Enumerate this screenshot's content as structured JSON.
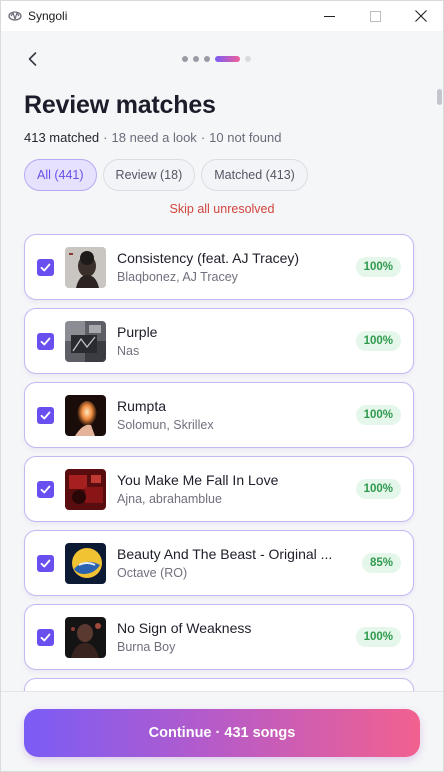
{
  "window": {
    "app_title": "Syngoli",
    "controls": {
      "minimize": "—",
      "maximize": "☐",
      "close": "✕"
    }
  },
  "header": {
    "title": "Review matches",
    "summary": {
      "matched": "413 matched",
      "need_look": "18 need a look",
      "not_found": "10 not found",
      "separator": "·"
    },
    "step": {
      "total": 5,
      "current": 4
    }
  },
  "filters": [
    {
      "label": "All (441)",
      "active": true
    },
    {
      "label": "Review (18)",
      "active": false
    },
    {
      "label": "Matched (413)",
      "active": false
    }
  ],
  "skip_link": "Skip all unresolved",
  "tracks": [
    {
      "title": "Consistency (feat. AJ Tracey)",
      "artist": "Blaqbonez, AJ Tracey",
      "match": "100%",
      "checked": true,
      "art": "art-consistency"
    },
    {
      "title": "Purple",
      "artist": "Nas",
      "match": "100%",
      "checked": true,
      "art": "art-purple"
    },
    {
      "title": "Rumpta",
      "artist": "Solomun, Skrillex",
      "match": "100%",
      "checked": true,
      "art": "art-rumpta"
    },
    {
      "title": "You Make Me Fall In Love",
      "artist": "Ajna, abrahamblue",
      "match": "100%",
      "checked": true,
      "art": "art-fall-in-love"
    },
    {
      "title": "Beauty And The Beast - Original ...",
      "artist": "Octave (RO)",
      "match": "85%",
      "checked": true,
      "art": "art-beauty"
    },
    {
      "title": "No Sign of Weakness",
      "artist": "Burna Boy",
      "match": "100%",
      "checked": true,
      "art": "art-no-sign"
    }
  ],
  "continue_button": "Continue · 431 songs",
  "colors": {
    "accent": "#6a4ff0",
    "danger": "#d2453d",
    "success": "#2f9a4e",
    "gradient_start": "#7a5cf6",
    "gradient_end": "#f2618f"
  }
}
